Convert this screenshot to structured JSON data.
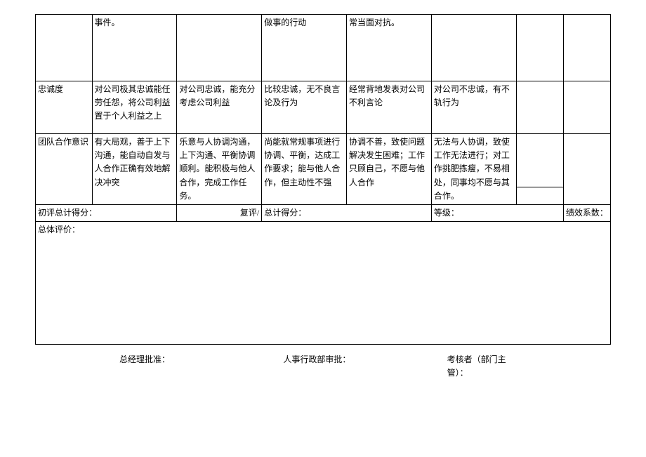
{
  "row0": {
    "col2": "事件。",
    "col4": "做事的行动",
    "col5": "常当面对抗。"
  },
  "loyalty": {
    "label": "忠诚度",
    "c2": "对公司极其忠诚能任劳任怨，将公司利益置于个人利益之上",
    "c3": "对公司忠诚，能充分考虑公司利益",
    "c4": "比较忠诚，无不良言论及行为",
    "c5": "经常背地发表对公司不利言论",
    "c6": "对公司不忠诚，有不轨行为"
  },
  "team": {
    "label": "团队合作意识",
    "c2": "有大局观，善于上下沟通，能自动自发与人合作正确有效地解决冲突",
    "c3": "乐意与人协调沟通，上下沟通、平衡协调顺利。能积极与他人合作，完成工作任务。",
    "c4": "尚能就常规事项进行协调、平衡，达成工作要求；能与他人合作，但主动性不强",
    "c5": "协调不善，致使问题解决发生困难；工作只顾自己，不愿与他人合作",
    "c6": "无法与人协调，致使工作无法进行；对工作挑肥拣瘦，不易相处，同事均不愿与其合作。"
  },
  "scores": {
    "prelim_label": "初评总计得分：",
    "review_label": "复评/",
    "total_label": "总计得分：",
    "grade_label": "等级：",
    "coeff_label": "绩效系数："
  },
  "comment": {
    "label": "总体评价："
  },
  "signatures": {
    "gm": "总经理批准：",
    "hr": "人事行政部审批：",
    "assessor": "考核者（部门主\n管）："
  }
}
